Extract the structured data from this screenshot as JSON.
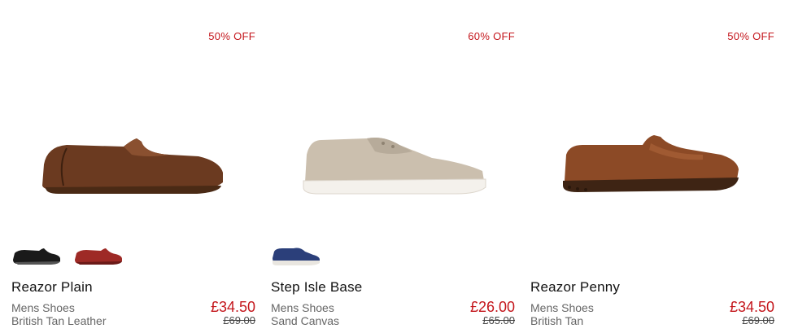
{
  "products": [
    {
      "discount": "50% OFF",
      "name": "Reazor Plain",
      "category": "Mens Shoes",
      "colour": "British Tan Leather",
      "price": "£34.50",
      "was_price": "£69.00",
      "image_color": "#6b3a20",
      "swatches": [
        {
          "name": "black-loafer",
          "color": "#1a1a1a"
        },
        {
          "name": "red-loafer",
          "color": "#9e2a26"
        }
      ]
    },
    {
      "discount": "60% OFF",
      "name": "Step Isle Base",
      "category": "Mens Shoes",
      "colour": "Sand Canvas",
      "price": "£26.00",
      "was_price": "£65.00",
      "image_color": "#cbbfae",
      "swatches": [
        {
          "name": "navy-boat-shoe",
          "color": "#2b3f7a"
        }
      ]
    },
    {
      "discount": "50% OFF",
      "name": "Reazor Penny",
      "category": "Mens Shoes",
      "colour": "British Tan",
      "price": "£34.50",
      "was_price": "£69.00",
      "image_color": "#8c4a26",
      "swatches": []
    }
  ],
  "colors": {
    "sale_red": "#c4161c"
  }
}
